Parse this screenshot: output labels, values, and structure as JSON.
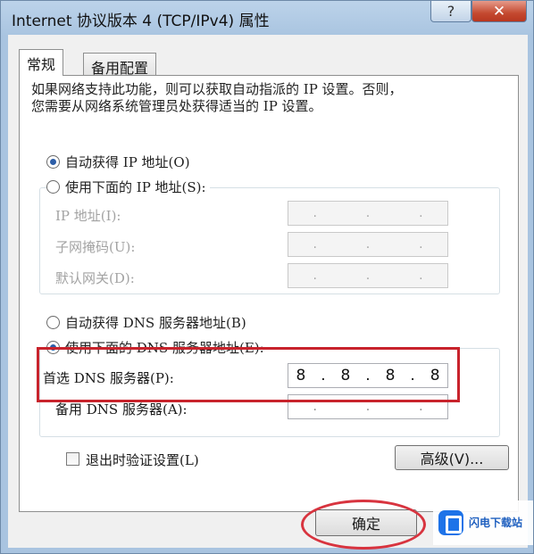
{
  "window": {
    "title": "Internet 协议版本 4 (TCP/IPv4) 属性",
    "help_label": "?",
    "close_label": "✕"
  },
  "tabs": [
    {
      "label": "常规"
    },
    {
      "label": "备用配置"
    }
  ],
  "description": {
    "line1": "如果网络支持此功能，则可以获取自动指派的 IP 设置。否则，",
    "line2": "您需要从网络系统管理员处获得适当的 IP 设置。"
  },
  "ip_mode": {
    "auto_label": "自动获得 IP 地址(O)",
    "manual_label": "使用下面的 IP 地址(S):",
    "selected": "auto"
  },
  "ip_fields": [
    {
      "label": "IP 地址(I):",
      "value": ". . ."
    },
    {
      "label": "子网掩码(U):",
      "value": ". . ."
    },
    {
      "label": "默认网关(D):",
      "value": ". . ."
    }
  ],
  "dns_mode": {
    "auto_label": "自动获得 DNS 服务器地址(B)",
    "manual_label": "使用下面的 DNS 服务器地址(E):",
    "selected": "manual"
  },
  "dns_fields": {
    "preferred": {
      "label": "首选 DNS 服务器(P):",
      "octets": [
        "8",
        "8",
        "8",
        "8"
      ]
    },
    "alternate": {
      "label": "备用 DNS 服务器(A):",
      "octets": [
        "",
        "",
        "",
        ""
      ]
    }
  },
  "validate": {
    "label": "退出时验证设置(L)",
    "checked": false
  },
  "advanced_button": "高级(V)...",
  "ok_button": "确定",
  "watermark": {
    "name": "闪电下载站"
  },
  "colors": {
    "annotation": "#c8232c",
    "radio_dot": "#2d5ea8",
    "watermark_blue": "#1e73e8"
  }
}
